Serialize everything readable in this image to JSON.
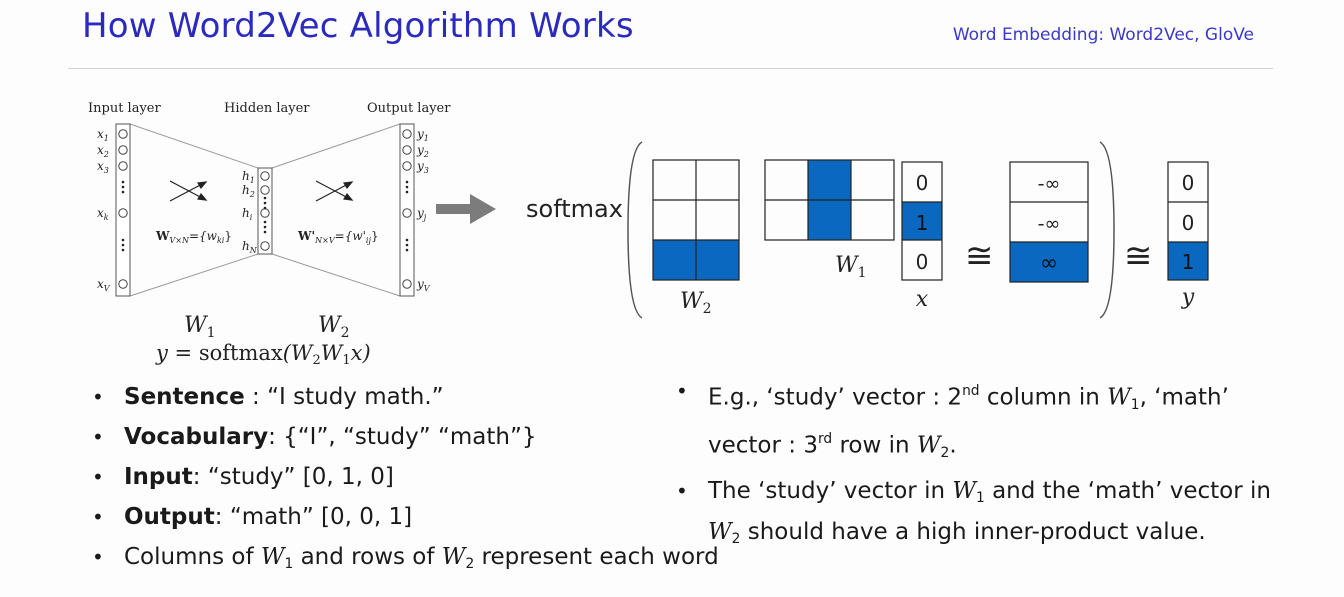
{
  "header": {
    "title": "How Word2Vec Algorithm Works",
    "subtitle": "Word Embedding: Word2Vec, GloVe"
  },
  "network": {
    "input_label": "Input layer",
    "hidden_label": "Hidden layer",
    "output_label": "Output layer",
    "input_nodes": [
      "x",
      "x",
      "x",
      "x",
      "x"
    ],
    "input_subs": [
      "1",
      "2",
      "3",
      "k",
      "V"
    ],
    "hidden_nodes": [
      "h",
      "h",
      "h",
      "h"
    ],
    "hidden_subs": [
      "1",
      "2",
      "i",
      "N"
    ],
    "output_nodes": [
      "y",
      "y",
      "y",
      "y",
      "y"
    ],
    "output_subs": [
      "1",
      "2",
      "3",
      "j",
      "V"
    ],
    "w_left_main": "W",
    "w_left_sub": "V×N",
    "w_left_rhs": "={w",
    "w_left_rhs_sub": "ki",
    "w_left_end": "}",
    "w_right_main": "W'",
    "w_right_sub": "N×V",
    "w_right_rhs": "={w'",
    "w_right_rhs_sub": "ij",
    "w_right_end": "}",
    "w1_label": "W",
    "w1_sub": "1",
    "w2_label": "W",
    "w2_sub": "2",
    "formula_lhs": "y = ",
    "formula_fn": "softmax",
    "formula_args": "(W",
    "formula_s2": "2",
    "formula_mid": "W",
    "formula_s1": "1",
    "formula_end": "x)"
  },
  "matrix_panel": {
    "softmax_label": "softmax",
    "w2_label": "W",
    "w2_sub": "2",
    "w1_label": "W",
    "w1_sub": "1",
    "x_label": "x",
    "y_label": "y",
    "x_values": [
      "0",
      "1",
      "0"
    ],
    "mid_values": [
      "-∞",
      "-∞",
      "∞"
    ],
    "y_values": [
      "0",
      "0",
      "1"
    ],
    "approx_symbol": "≅",
    "accent_color": "#0a68c0"
  },
  "left_bullets": [
    {
      "bold": "Sentence",
      "text": " : “I study math.”"
    },
    {
      "bold": "Vocabulary",
      "text": ": {“I”, “study” “math”}"
    },
    {
      "bold": "Input",
      "text": ": “study”   [0, 1, 0]"
    },
    {
      "bold": "Output",
      "text": ": “math”   [0, 0, 1]"
    }
  ],
  "bottom_bullet": {
    "t1": "Columns of ",
    "w1": "W",
    "s1": "1",
    "t2": " and rows of ",
    "w2": "W",
    "s2": "2",
    "t3": " represent each word"
  },
  "right_bullets": {
    "b1_t1": "E.g., ‘study’ vector :  2",
    "b1_sup1": "nd",
    "b1_t2": " column in ",
    "b1_w1": "W",
    "b1_s1": "1",
    "b1_t3": ", ‘math’ vector : 3",
    "b1_sup2": "rd",
    "b1_t4": "  row in ",
    "b1_w2": "W",
    "b1_s2": "2",
    "b1_t5": ".",
    "b2_t1": "The ‘study’ vector in ",
    "b2_w1": "W",
    "b2_s1": "1",
    "b2_t2": " and the ‘math’ vector in ",
    "b2_w2": "W",
    "b2_s2": "2",
    "b2_t3": " should have a high inner-product value."
  }
}
